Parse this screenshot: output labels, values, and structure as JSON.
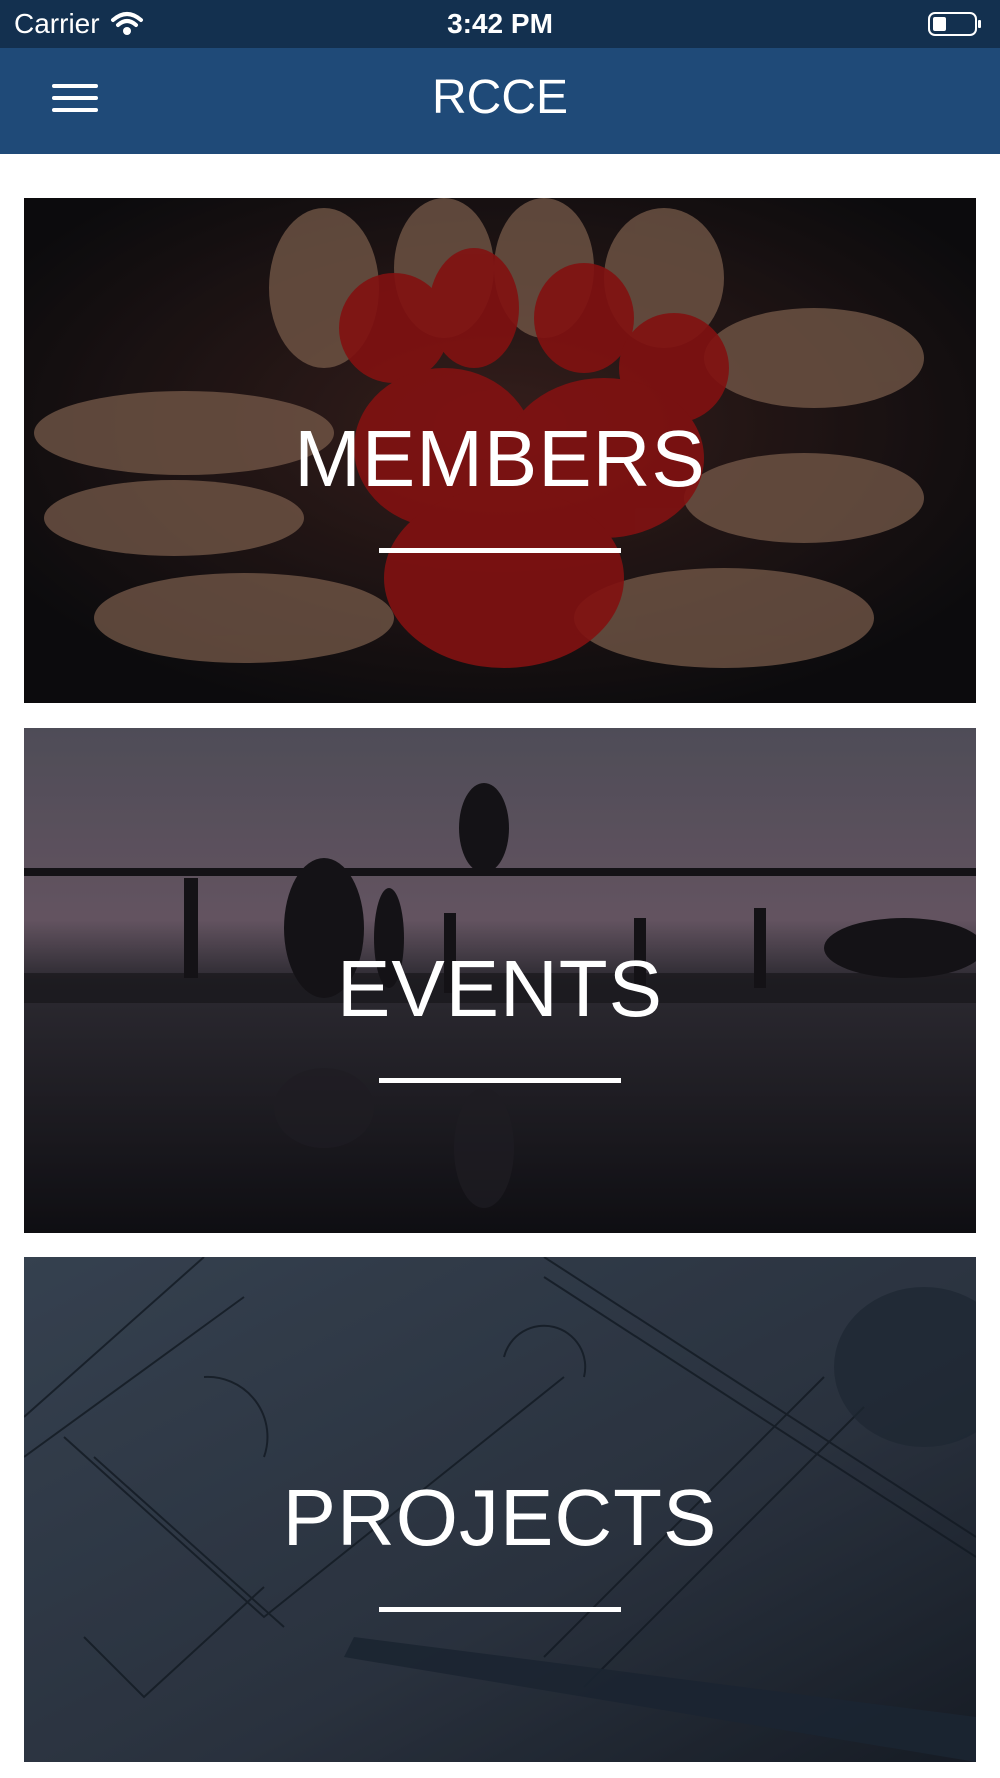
{
  "status_bar": {
    "carrier": "Carrier",
    "time": "3:42 PM"
  },
  "nav": {
    "title": "RCCE",
    "menu_icon": "hamburger-menu-icon"
  },
  "cards": [
    {
      "label": "MEMBERS",
      "image": "painted-hands-photo"
    },
    {
      "label": "EVENTS",
      "image": "pier-sunset-jump-photo"
    },
    {
      "label": "PROJECTS",
      "image": "blueprint-drawing-photo"
    }
  ],
  "colors": {
    "status_bar": "#13304f",
    "nav_bar": "#1f4a78",
    "text": "#ffffff"
  }
}
